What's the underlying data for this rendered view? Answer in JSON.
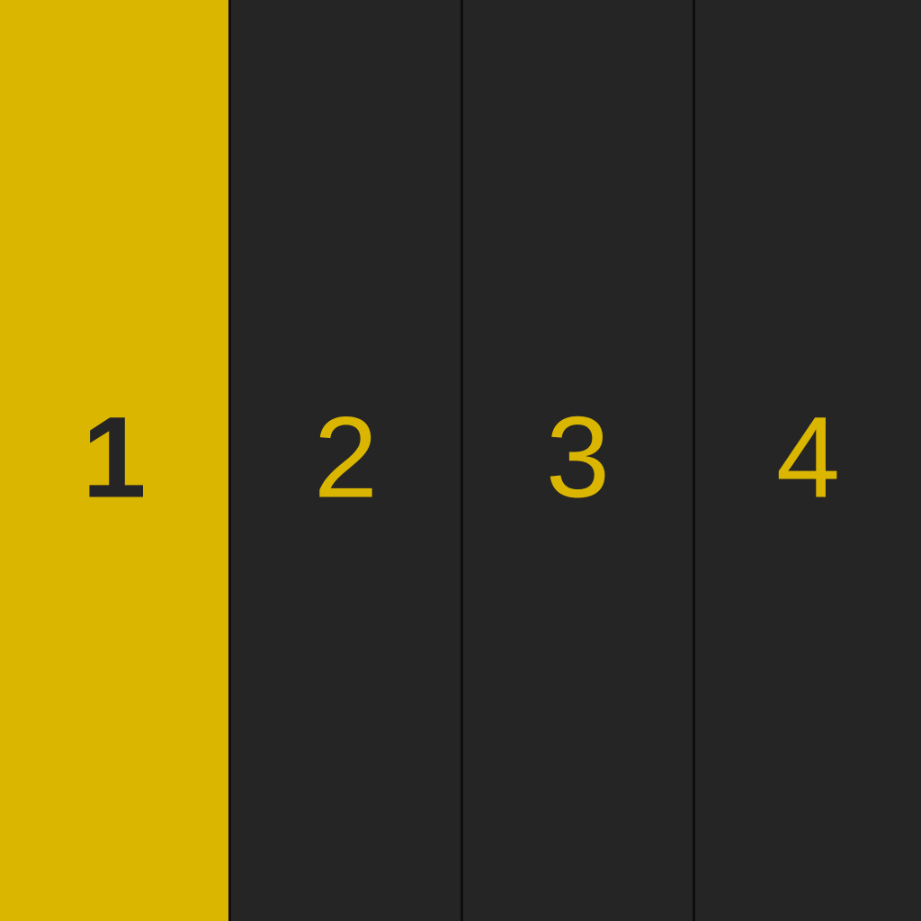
{
  "selector": {
    "items": [
      {
        "label": "1",
        "selected": true,
        "background_color": "#DAB600",
        "label_color": "#252525"
      },
      {
        "label": "2",
        "selected": false,
        "background_color": "#252525",
        "label_color": "#DAB600"
      },
      {
        "label": "3",
        "selected": false,
        "background_color": "#252525",
        "label_color": "#DAB600"
      },
      {
        "label": "4",
        "selected": false,
        "background_color": "#252525",
        "label_color": "#DAB600"
      }
    ]
  }
}
